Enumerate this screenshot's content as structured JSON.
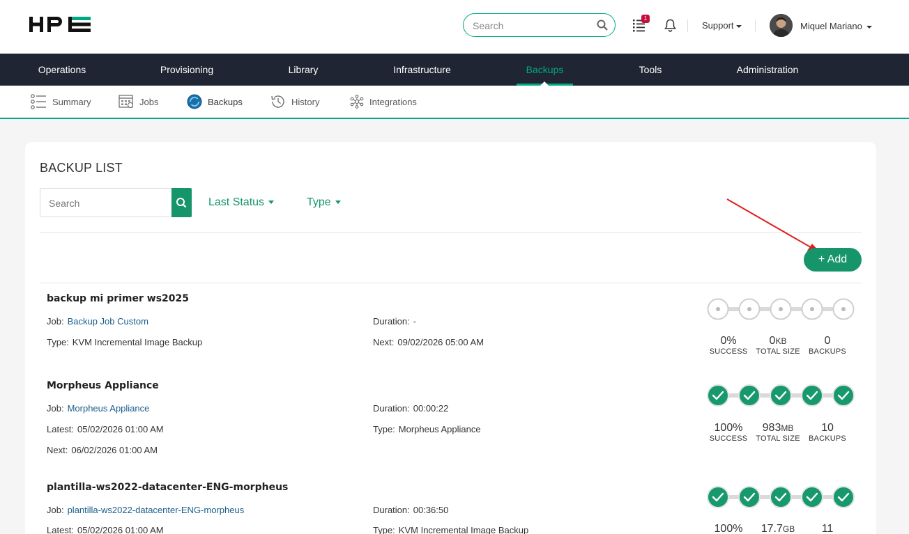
{
  "header": {
    "brand": "HPE",
    "search_placeholder": "Search",
    "tasks_badge": "1",
    "support_label": "Support",
    "user_name": "Miquel Mariano"
  },
  "main_nav": [
    "Operations",
    "Provisioning",
    "Library",
    "Infrastructure",
    "Backups",
    "Tools",
    "Administration"
  ],
  "main_nav_active": "Backups",
  "sub_nav": [
    "Summary",
    "Jobs",
    "Backups",
    "History",
    "Integrations"
  ],
  "sub_nav_active": "Backups",
  "colors": {
    "accent": "#01a982",
    "button": "#16956a",
    "nav_bg": "#1f2532",
    "link": "#1a5e8a"
  },
  "card": {
    "title": "BACKUP LIST",
    "search_placeholder": "Search",
    "filter_status": "Last Status",
    "filter_type": "Type",
    "add_label": "+ Add"
  },
  "backups": [
    {
      "name": "backup mi primer ws2025",
      "job_label": "Job:",
      "job": "Backup Job Custom",
      "type_label": "Type:",
      "type": "KVM Incremental Image Backup",
      "duration_label": "Duration:",
      "duration": "-",
      "next_label": "Next:",
      "next": "09/02/2026 05:00 AM",
      "success": "0%",
      "total_size": "0",
      "total_size_unit": "KB",
      "backups_count": "0",
      "success_cap": "SUCCESS",
      "size_cap": "TOTAL SIZE",
      "count_cap": "BACKUPS"
    },
    {
      "name": "Morpheus Appliance",
      "job_label": "Job:",
      "job": "Morpheus Appliance",
      "latest_label": "Latest:",
      "latest": "05/02/2026 01:00 AM",
      "next_label": "Next:",
      "next": "06/02/2026 01:00 AM",
      "duration_label": "Duration:",
      "duration": "00:00:22",
      "type_label": "Type:",
      "type": "Morpheus Appliance",
      "success": "100%",
      "total_size": "983",
      "total_size_unit": "MB",
      "backups_count": "10",
      "success_cap": "SUCCESS",
      "size_cap": "TOTAL SIZE",
      "count_cap": "BACKUPS"
    },
    {
      "name": "plantilla-ws2022-datacenter-ENG-morpheus",
      "job_label": "Job:",
      "job": "plantilla-ws2022-datacenter-ENG-morpheus",
      "latest_label": "Latest:",
      "latest": "05/02/2026 01:00 AM",
      "duration_label": "Duration:",
      "duration": "00:36:50",
      "type_label": "Type:",
      "type": "KVM Incremental Image Backup",
      "success": "100%",
      "total_size": "17.7",
      "total_size_unit": "GB",
      "backups_count": "11"
    }
  ]
}
